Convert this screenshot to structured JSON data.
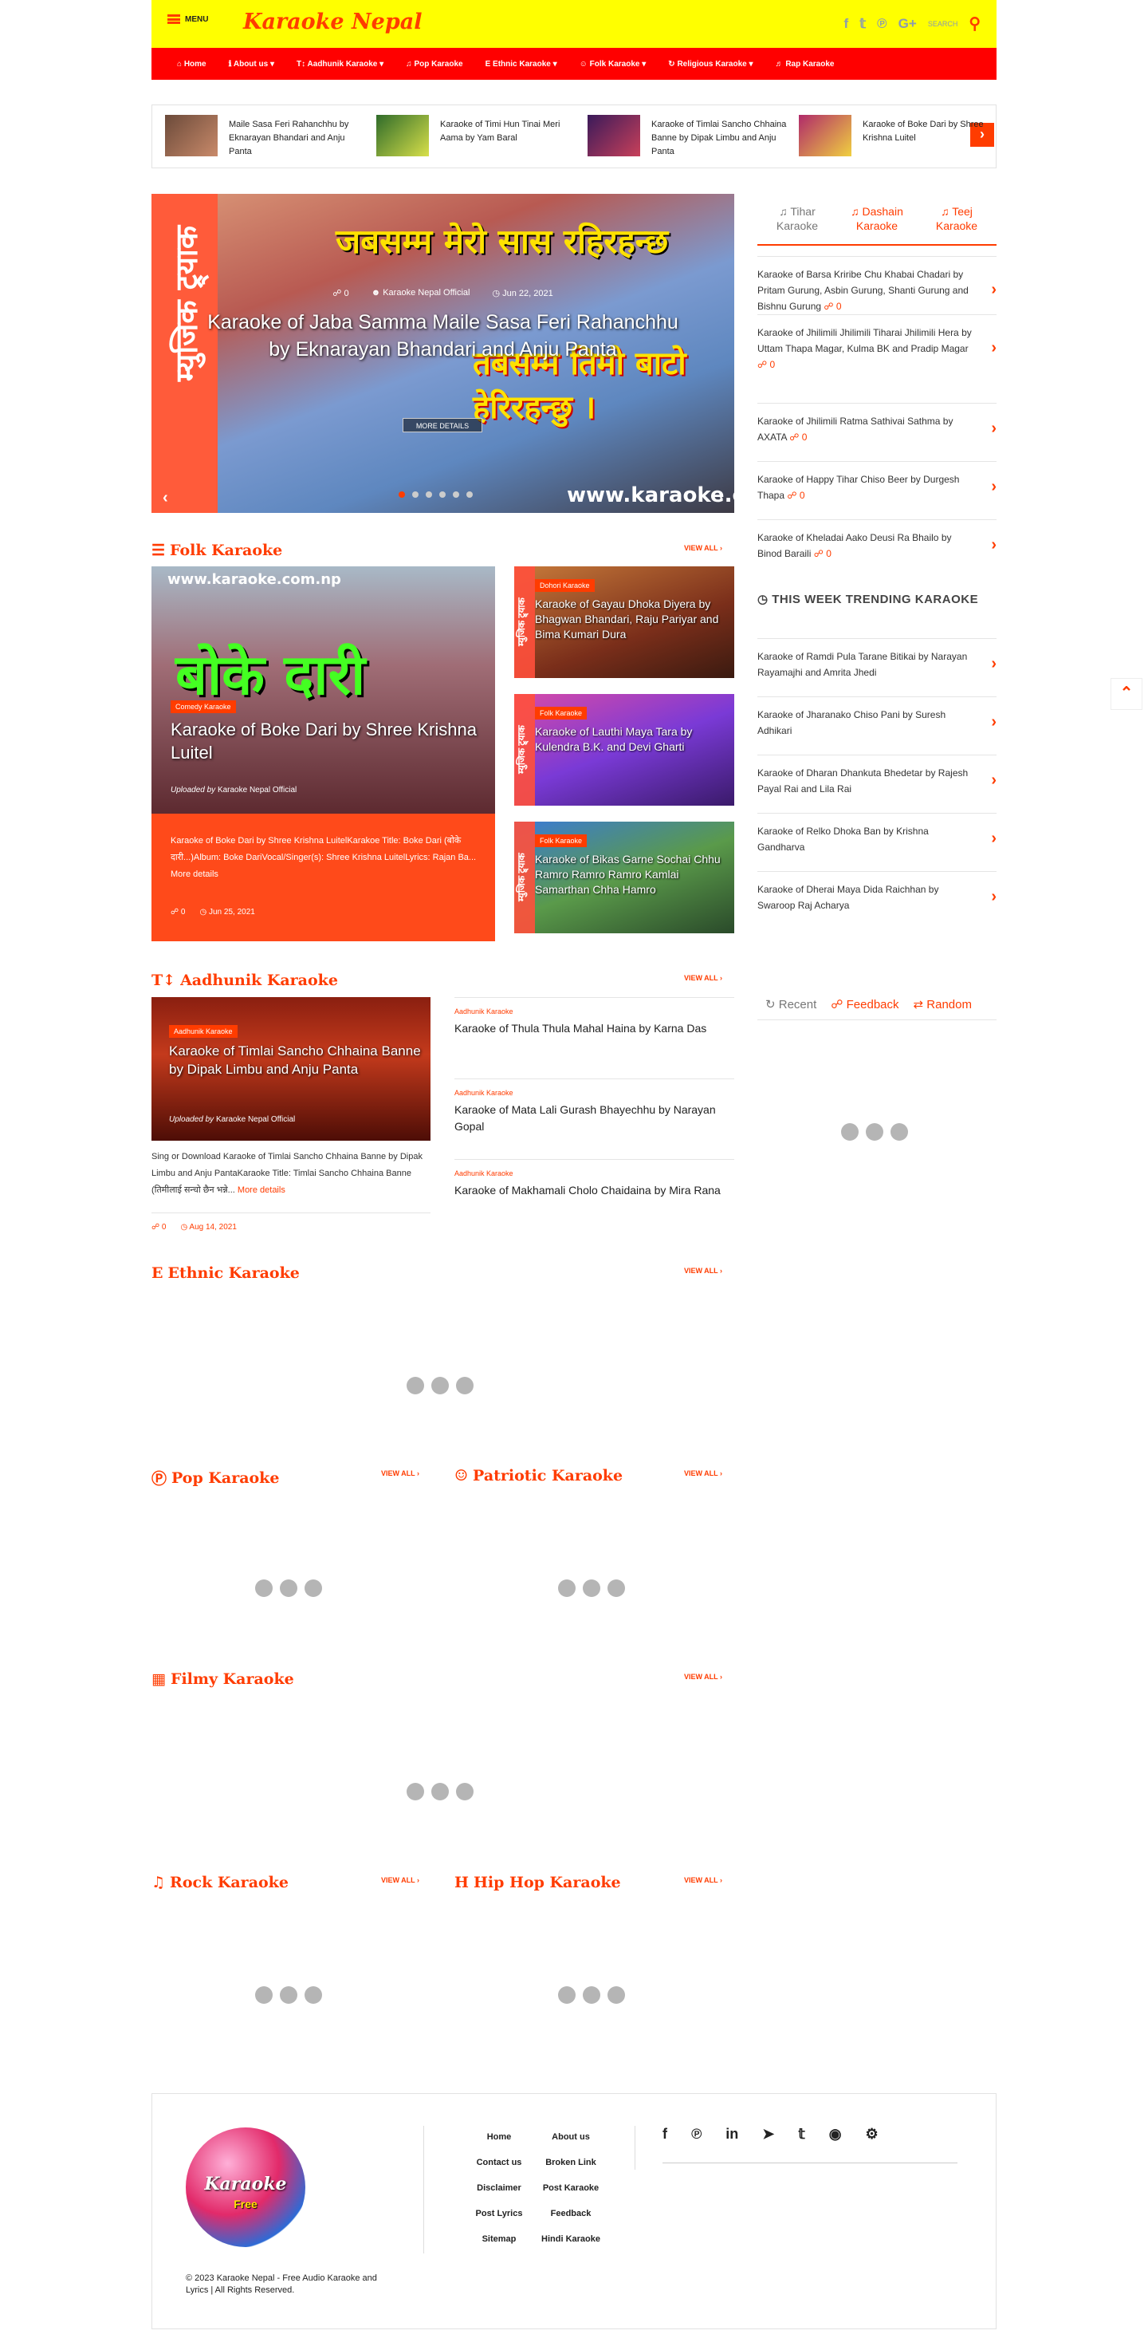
{
  "header": {
    "menu_label": "MENU",
    "logo": "Karaoke Nepal",
    "search_label": "SEARCH",
    "social_icons": [
      "facebook-icon",
      "twitter-icon",
      "pinterest-icon",
      "google-plus-icon"
    ]
  },
  "nav": {
    "items": [
      {
        "icon": "⌂",
        "label": "Home"
      },
      {
        "icon": "ℹ",
        "label": "About us",
        "dropdown": true
      },
      {
        "icon": "T↕",
        "label": "Aadhunik Karaoke",
        "dropdown": true
      },
      {
        "icon": "♫",
        "label": "Pop Karaoke"
      },
      {
        "icon": "E",
        "label": "Ethnic Karaoke",
        "dropdown": true
      },
      {
        "icon": "☺",
        "label": "Folk Karaoke",
        "dropdown": true
      },
      {
        "icon": "↻",
        "label": "Religious Karaoke",
        "dropdown": true
      },
      {
        "icon": "♬",
        "label": "Rap Karaoke"
      }
    ]
  },
  "strip": {
    "items": [
      {
        "text": "Maile Sasa Feri Rahanchhu by Eknarayan Bhandari and Anju Panta"
      },
      {
        "text": "Karaoke of Timi Hun Tinai Meri Aama by Yam Baral"
      },
      {
        "text": "Karaoke of Timlai Sancho Chhaina Banne by Dipak Limbu and Anju Panta"
      },
      {
        "text": "Karaoke of Boke Dari by Shree Krishna Luitel"
      }
    ],
    "next": "›"
  },
  "hero": {
    "vertical_text": "म्युजिक ट्र्याक",
    "top_text": "जबसम्म मेरो सास रहिरहन्छ",
    "big_text": "तबसम्म तिमो बाटो हेरिरहन्छु ।",
    "url": "www.karaoke.com.np",
    "comments": "0",
    "author": "Karaoke Nepal Official",
    "date": "Jun 22, 2021",
    "title": "Karaoke of Jaba Samma Maile Sasa Feri Rahanchhu by Eknarayan Bhandari and Anju Panta",
    "more": "MORE DETAILS",
    "dots": 6,
    "active_dot": 0
  },
  "folk": {
    "heading": "Folk Karaoke",
    "view_all": "VIEW ALL",
    "main": {
      "img_text": "बोके दारी",
      "img_url": "www.karaoke.com.np",
      "badge": "Comedy Karaoke",
      "title": "Karaoke of Boke Dari by Shree Krishna Luitel",
      "uploaded_label": "Uploaded by",
      "uploader": "Karaoke Nepal Official",
      "desc": "Karaoke of Boke Dari by Shree Krishna LuitelKarakoe Title: Boke Dari (बोके दारी...)Album: Boke DariVocal/Singer(s): Shree Krishna LuitelLyrics: Rajan Ba...",
      "more": "More details",
      "comments": "0",
      "date": "Jun 25, 2021"
    },
    "cards": [
      {
        "badge": "Dohori Karaoke",
        "title": "Karaoke of Gayau Dhoka Diyera by Bhagwan Bhandari, Raju Pariyar and Bima Kumari Dura",
        "vertical": "म्युजिक ट्र्याक"
      },
      {
        "badge": "Folk Karaoke",
        "title": "Karaoke of Lauthi Maya Tara by Kulendra B.K. and Devi Gharti",
        "vertical": "म्युजिक ट्र्याक"
      },
      {
        "badge": "Folk Karaoke",
        "title": "Karaoke of Bikas Garne Sochai Chhu Ramro Ramro Ramro Kamlai Samarthan Chha Hamro",
        "vertical": "म्युजिक ट्र्याक"
      }
    ]
  },
  "aadhunik": {
    "heading": "Aadhunik Karaoke",
    "view_all": "VIEW ALL",
    "main": {
      "badge": "Aadhunik Karaoke",
      "title": "Karaoke of Timlai Sancho Chhaina Banne by Dipak Limbu and Anju Panta",
      "uploaded_label": "Uploaded by",
      "uploader": "Karaoke Nepal Official",
      "desc": "Sing or Download Karaoke of Timlai Sancho Chhaina Banne by Dipak Limbu and Anju PantaKaraoke Title: Timlai Sancho Chhaina Banne (तिमीलाई सन्चो छैन भन्ने...",
      "more": "More details",
      "comments": "0",
      "date": "Aug 14, 2021"
    },
    "items": [
      {
        "cat": "Aadhunik Karaoke",
        "name": "Karaoke of Thula Thula Mahal Haina by Karna Das"
      },
      {
        "cat": "Aadhunik Karaoke",
        "name": "Karaoke of Mata Lali Gurash Bhayechhu by Narayan Gopal"
      },
      {
        "cat": "Aadhunik Karaoke",
        "name": "Karaoke of Makhamali Cholo Chaidaina by Mira Rana"
      }
    ]
  },
  "sections": {
    "ethnic": {
      "heading": "Ethnic Karaoke",
      "view_all": "VIEW ALL"
    },
    "pop": {
      "heading": "Pop Karaoke",
      "view_all": "VIEW ALL"
    },
    "patriotic": {
      "heading": "Patriotic Karaoke",
      "view_all": "VIEW ALL"
    },
    "filmy": {
      "heading": "Filmy Karaoke",
      "view_all": "VIEW ALL"
    },
    "rock": {
      "heading": "Rock Karaoke",
      "view_all": "VIEW ALL"
    },
    "hiphop": {
      "heading": "Hip Hop Karaoke",
      "view_all": "VIEW ALL"
    }
  },
  "sidebar": {
    "tabs": [
      {
        "label": "Tihar Karaoke",
        "active": false
      },
      {
        "label": "Dashain Karaoke",
        "active": true
      },
      {
        "label": "Teej Karaoke",
        "active": true
      }
    ],
    "items": [
      {
        "title": "Karaoke of Barsa Kriribe Chu Khabai Chadari by Pritam Gurung, Asbin Gurung, Shanti Gurung and Bishnu Gurung",
        "comments": "0"
      },
      {
        "title": "Karaoke of Jhilimili Jhilimili Tiharai Jhilimili Hera by Uttam Thapa Magar, Kulma BK and Pradip Magar",
        "comments": "0"
      },
      {
        "title": "Karaoke of Jhilimili Ratma Sathivai Sathma by AXATA",
        "comments": "0"
      },
      {
        "title": "Karaoke of Happy Tihar Chiso Beer by Durgesh Thapa",
        "comments": "0"
      },
      {
        "title": "Karaoke of Kheladai Aako Deusi Ra Bhailo by Binod Baraili",
        "comments": "0"
      }
    ],
    "trending_heading": "THIS WEEK TRENDING KARAOKE",
    "trending": [
      {
        "title": "Karaoke of Ramdi Pula Tarane Bitikai by Narayan Rayamajhi and Amrita Jhedi"
      },
      {
        "title": "Karaoke of Jharanako Chiso Pani by Suresh Adhikari"
      },
      {
        "title": "Karaoke of Dharan Dhankuta Bhedetar by Rajesh Payal Rai and Lila Rai"
      },
      {
        "title": "Karaoke of Relko Dhoka Ban by Krishna Gandharva"
      },
      {
        "title": "Karaoke of Dherai Maya Dida Raichhan by Swaroop Raj Acharya"
      }
    ],
    "tabs2": [
      {
        "label": "Recent",
        "active": false
      },
      {
        "label": "Feedback",
        "active": true
      },
      {
        "label": "Random",
        "active": true
      }
    ]
  },
  "footer": {
    "logo_text": "Karaoke",
    "logo_sub": "Free",
    "copyright": "© 2023 Karaoke Nepal - Free Audio Karaoke and Lyrics | All Rights Reserved.",
    "links": [
      "Home",
      "About us",
      "Contact us",
      "Broken Link",
      "Disclaimer",
      "Post Karaoke",
      "Post Lyrics",
      "Feedback",
      "Sitemap",
      "Hindi Karaoke"
    ],
    "social_icons": [
      "facebook-icon",
      "pinterest-icon",
      "linkedin-icon",
      "telegram-icon",
      "twitter-icon",
      "rss-icon",
      "android-icon"
    ]
  },
  "colors": {
    "accent": "#ff3c00",
    "topbar": "#ffff00",
    "navbar": "#ff0000"
  }
}
